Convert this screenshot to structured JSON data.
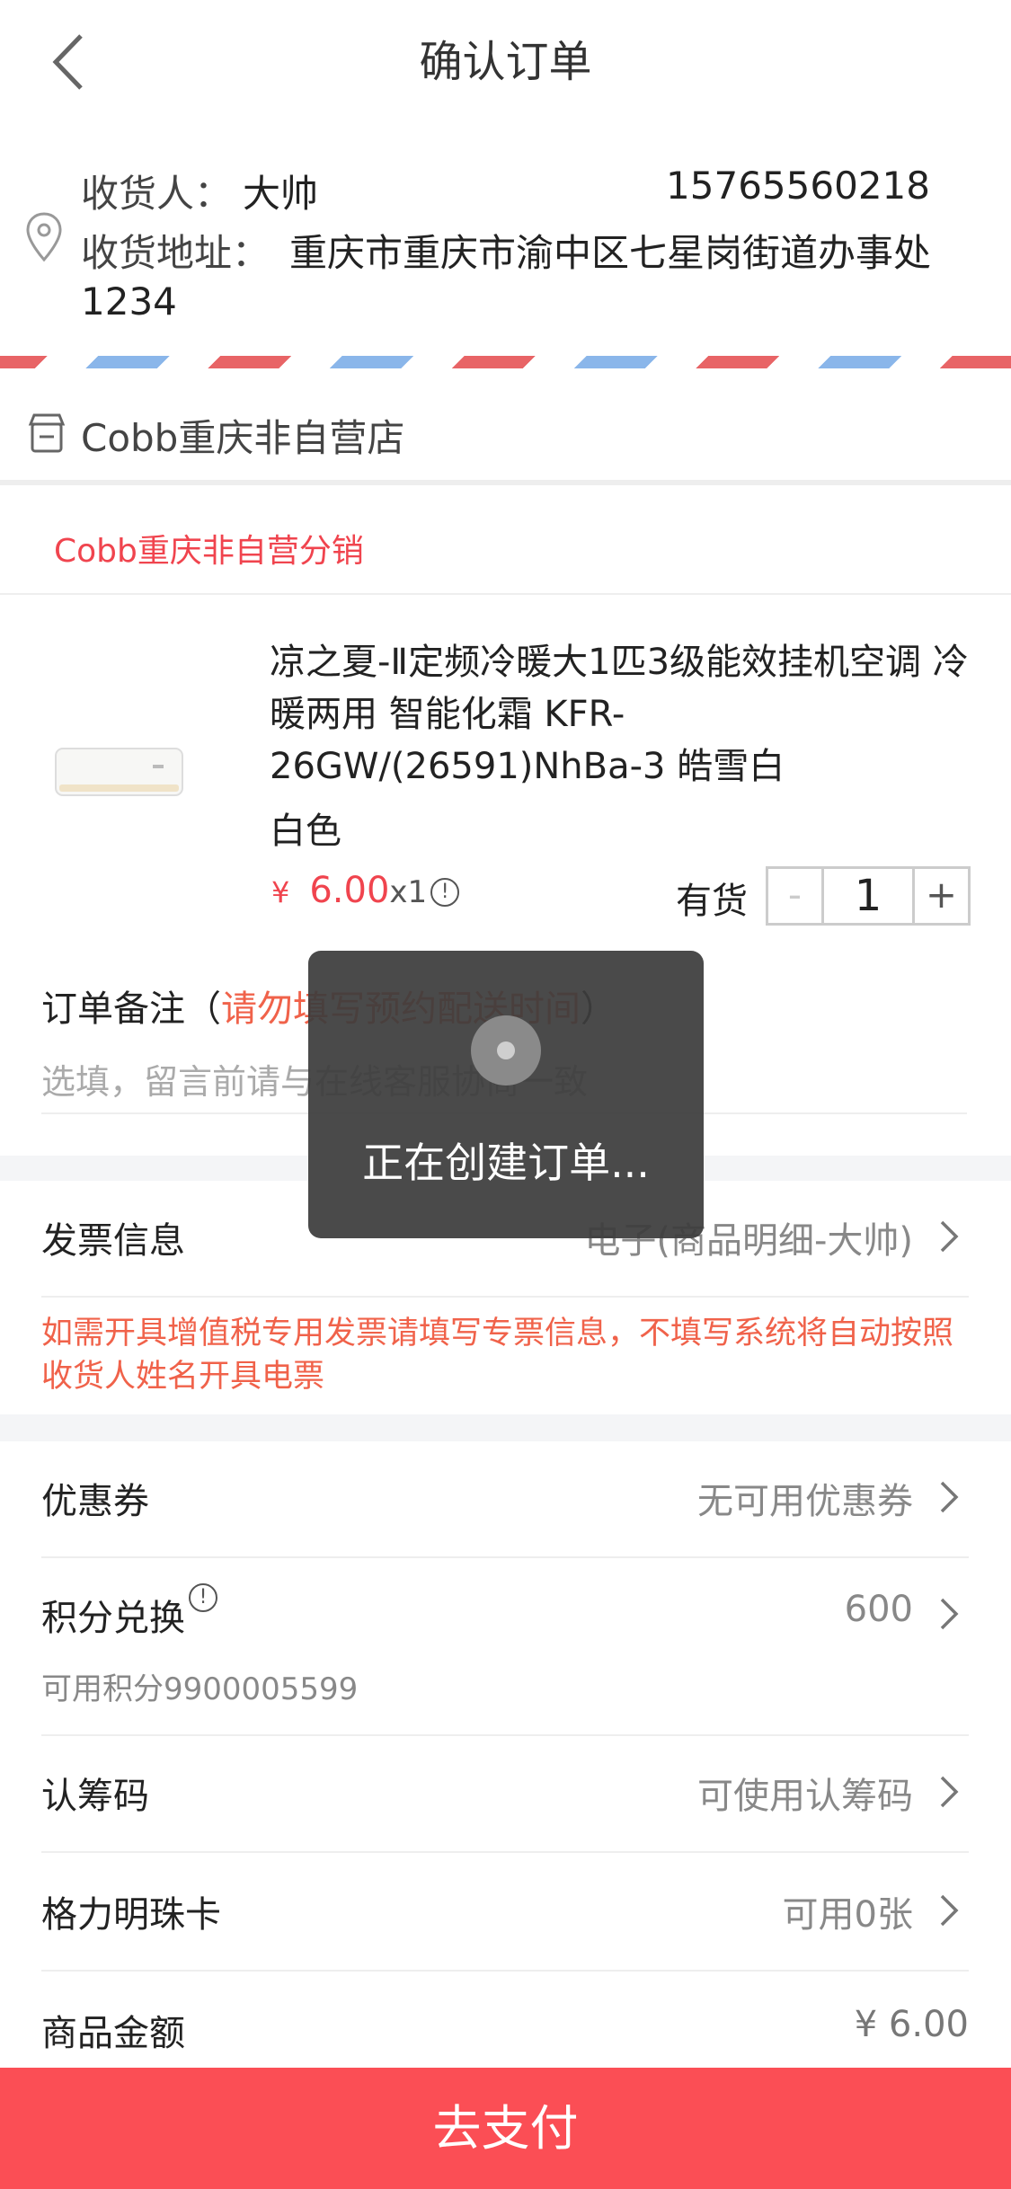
{
  "header": {
    "title": "确认订单"
  },
  "address": {
    "receiver_label": "收货人：",
    "receiver_name": "大帅",
    "phone": "15765560218",
    "address_label": "收货地址：",
    "address": "重庆市重庆市渝中区七星岗街道办事处1234"
  },
  "shop": {
    "name": "Cobb重庆非自营店",
    "distributor": "Cobb重庆非自营分销"
  },
  "product": {
    "title": "凉之夏-Ⅱ定频冷暖大1匹3级能效挂机空调 冷暖两用 智能化霜 KFR-26GW/(26591)NhBa-3 皓雪白",
    "color": "白色",
    "currency": "¥",
    "price": "6.00",
    "qty_text": "x1",
    "info_glyph": "!",
    "stock": "有货",
    "minus": "-",
    "plus": "+",
    "quantity": "1"
  },
  "remark": {
    "label": "订单备注（",
    "hint": "请勿填写预约配送时间",
    "close": "）",
    "placeholder": "选填，留言前请与在线客服协商一致"
  },
  "invoice": {
    "label": "发票信息",
    "value": "电子(商品明细-大帅)",
    "note": "如需开具增值税专用发票请填写专票信息，不填写系统将自动按照收货人姓名开具电票"
  },
  "rows": {
    "coupon": {
      "label": "优惠券",
      "value": "无可用优惠券"
    },
    "points": {
      "label": "积分兑换",
      "value": "600",
      "sub": "可用积分9900005599"
    },
    "code": {
      "label": "认筹码",
      "value": "可使用认筹码"
    },
    "card": {
      "label": "格力明珠卡",
      "value": "可用0张"
    },
    "amount": {
      "label": "商品金额",
      "value": "¥ 6.00"
    }
  },
  "toast": {
    "text": "正在创建订单..."
  },
  "pay": {
    "label": "去支付"
  },
  "colors": {
    "accent": "#fb4e55",
    "price": "#f0444e",
    "hint": "#f0624a"
  }
}
